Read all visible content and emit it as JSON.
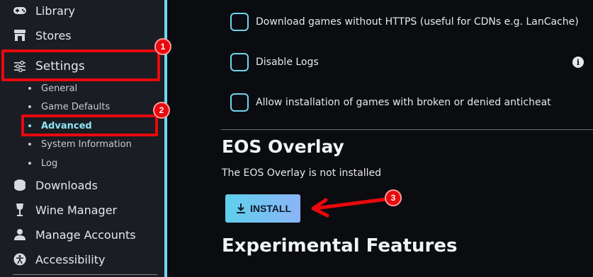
{
  "sidebar": {
    "items": [
      {
        "label": "Library",
        "icon": "gamepad-icon"
      },
      {
        "label": "Stores",
        "icon": "store-icon"
      },
      {
        "label": "Settings",
        "icon": "sliders-icon"
      },
      {
        "label": "Downloads",
        "icon": "download-icon"
      },
      {
        "label": "Wine Manager",
        "icon": "wine-glass-icon"
      },
      {
        "label": "Manage Accounts",
        "icon": "user-icon"
      },
      {
        "label": "Accessibility",
        "icon": "accessibility-icon"
      }
    ],
    "settings_sub": [
      {
        "label": "General"
      },
      {
        "label": "Game Defaults"
      },
      {
        "label": "Advanced",
        "active": true
      },
      {
        "label": "System Information"
      },
      {
        "label": "Log"
      }
    ]
  },
  "main": {
    "checkboxes": [
      {
        "label": "Download games without HTTPS (useful for CDNs e.g. LanCache)",
        "checked": false
      },
      {
        "label": "Disable Logs",
        "checked": false
      },
      {
        "label": "Allow installation of games with broken or denied anticheat",
        "checked": false
      }
    ],
    "info_icon_glyph": "i",
    "eos": {
      "title": "EOS Overlay",
      "status": "The EOS Overlay is not installed",
      "install_label": "INSTALL"
    },
    "experimental_title": "Experimental Features"
  },
  "annotations": {
    "badges": [
      "1",
      "2",
      "3"
    ],
    "color": "#e8090d"
  },
  "colors": {
    "accent": "#6fd6f0",
    "sidebar_bg": "#1a1d23",
    "main_bg": "#0b0c10",
    "active_sub": "#8fe4f7"
  }
}
